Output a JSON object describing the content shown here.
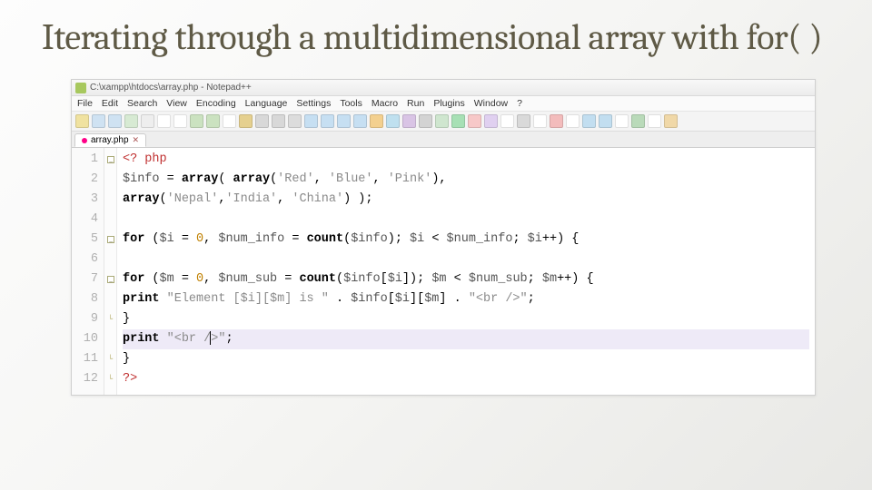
{
  "slide": {
    "title": "Iterating through a multidimensional array with for( )"
  },
  "window": {
    "title": "C:\\xampp\\htdocs\\array.php - Notepad++"
  },
  "menu": {
    "items": [
      "File",
      "Edit",
      "Search",
      "View",
      "Encoding",
      "Language",
      "Settings",
      "Tools",
      "Macro",
      "Run",
      "Plugins",
      "Window",
      "?"
    ]
  },
  "toolbar_colors": [
    "#f0e2a0",
    "#cfe2f2",
    "#cfe2f2",
    "#d7ead3",
    "#eee",
    "#fff",
    "#fff",
    "#cbe2c0",
    "#cbe2c0",
    "#fff",
    "#e5d08f",
    "#d8d8d8",
    "#d8d8d8",
    "#dcdcdc",
    "#c6dff2",
    "#c6dff2",
    "#c6dff2",
    "#c6dff2",
    "#f3d08f",
    "#bfe0ef",
    "#d9c4e5",
    "#d3d3d3",
    "#cfe6cf",
    "#a7e0b5",
    "#f7c8c8",
    "#e0d0f0",
    "#fff",
    "#d9d9d9",
    "#fff",
    "#f3bcbc",
    "#fff",
    "#c2def0",
    "#c2def0",
    "#fff",
    "#b9dab9",
    "#fff",
    "#f0d8a8"
  ],
  "tab": {
    "label": "array.php"
  },
  "code": {
    "lines": [
      {
        "n": 1,
        "fold": "box",
        "seg": [
          {
            "t": "<? php",
            "c": "kw-red"
          }
        ]
      },
      {
        "n": 2,
        "fold": "",
        "seg": [
          {
            "t": "$info",
            "c": "var"
          },
          {
            "t": " = ",
            "c": "op"
          },
          {
            "t": "array",
            "c": "kw-bold"
          },
          {
            "t": "( ",
            "c": "op"
          },
          {
            "t": "array",
            "c": "kw-bold"
          },
          {
            "t": "(",
            "c": "op"
          },
          {
            "t": "'Red'",
            "c": "str"
          },
          {
            "t": ", ",
            "c": "op"
          },
          {
            "t": "'Blue'",
            "c": "str"
          },
          {
            "t": ", ",
            "c": "op"
          },
          {
            "t": "'Pink'",
            "c": "str"
          },
          {
            "t": "),",
            "c": "op"
          }
        ]
      },
      {
        "n": 3,
        "fold": "",
        "seg": [
          {
            "t": "array",
            "c": "kw-bold"
          },
          {
            "t": "(",
            "c": "op"
          },
          {
            "t": "'Nepal'",
            "c": "str"
          },
          {
            "t": ",",
            "c": "op"
          },
          {
            "t": "'India'",
            "c": "str"
          },
          {
            "t": ", ",
            "c": "op"
          },
          {
            "t": "'China'",
            "c": "str"
          },
          {
            "t": ") );",
            "c": "op"
          }
        ]
      },
      {
        "n": 4,
        "fold": "",
        "seg": []
      },
      {
        "n": 5,
        "fold": "box",
        "seg": [
          {
            "t": "for",
            "c": "kw-bold"
          },
          {
            "t": " (",
            "c": "op"
          },
          {
            "t": "$i",
            "c": "var"
          },
          {
            "t": " = ",
            "c": "op"
          },
          {
            "t": "0",
            "c": "num"
          },
          {
            "t": ", ",
            "c": "op"
          },
          {
            "t": "$num_info",
            "c": "var"
          },
          {
            "t": " = ",
            "c": "op"
          },
          {
            "t": "count",
            "c": "kw-bold"
          },
          {
            "t": "(",
            "c": "op"
          },
          {
            "t": "$info",
            "c": "var"
          },
          {
            "t": "); ",
            "c": "op"
          },
          {
            "t": "$i",
            "c": "var"
          },
          {
            "t": " < ",
            "c": "op"
          },
          {
            "t": "$num_info",
            "c": "var"
          },
          {
            "t": "; ",
            "c": "op"
          },
          {
            "t": "$i",
            "c": "var"
          },
          {
            "t": "++) {",
            "c": "op"
          }
        ]
      },
      {
        "n": 6,
        "fold": "",
        "seg": []
      },
      {
        "n": 7,
        "fold": "box",
        "seg": [
          {
            "t": "for",
            "c": "kw-bold"
          },
          {
            "t": " (",
            "c": "op"
          },
          {
            "t": "$m",
            "c": "var"
          },
          {
            "t": " = ",
            "c": "op"
          },
          {
            "t": "0",
            "c": "num"
          },
          {
            "t": ", ",
            "c": "op"
          },
          {
            "t": "$num_sub",
            "c": "var"
          },
          {
            "t": " = ",
            "c": "op"
          },
          {
            "t": "count",
            "c": "kw-bold"
          },
          {
            "t": "(",
            "c": "op"
          },
          {
            "t": "$info",
            "c": "var"
          },
          {
            "t": "[",
            "c": "op"
          },
          {
            "t": "$i",
            "c": "var"
          },
          {
            "t": "]); ",
            "c": "op"
          },
          {
            "t": "$m",
            "c": "var"
          },
          {
            "t": " < ",
            "c": "op"
          },
          {
            "t": "$num_sub",
            "c": "var"
          },
          {
            "t": "; ",
            "c": "op"
          },
          {
            "t": "$m",
            "c": "var"
          },
          {
            "t": "++) {",
            "c": "op"
          }
        ]
      },
      {
        "n": 8,
        "fold": "",
        "seg": [
          {
            "t": "print",
            "c": "kw-bold"
          },
          {
            "t": " ",
            "c": "op"
          },
          {
            "t": "\"Element [$i][$m] is \"",
            "c": "str"
          },
          {
            "t": " . ",
            "c": "op"
          },
          {
            "t": "$info",
            "c": "var"
          },
          {
            "t": "[",
            "c": "op"
          },
          {
            "t": "$i",
            "c": "var"
          },
          {
            "t": "][",
            "c": "op"
          },
          {
            "t": "$m",
            "c": "var"
          },
          {
            "t": "] . ",
            "c": "op"
          },
          {
            "t": "\"<br />\"",
            "c": "str"
          },
          {
            "t": ";",
            "c": "op"
          }
        ]
      },
      {
        "n": 9,
        "fold": "close",
        "seg": [
          {
            "t": "}",
            "c": "op"
          }
        ]
      },
      {
        "n": 10,
        "fold": "",
        "current": true,
        "seg": [
          {
            "t": "print",
            "c": "kw-bold"
          },
          {
            "t": " ",
            "c": "op"
          },
          {
            "t": "\"<br /",
            "c": "str"
          },
          {
            "t": "",
            "cursor": true
          },
          {
            "t": ">\"",
            "c": "str"
          },
          {
            "t": ";",
            "c": "op"
          }
        ]
      },
      {
        "n": 11,
        "fold": "close",
        "seg": [
          {
            "t": "}",
            "c": "op"
          }
        ]
      },
      {
        "n": 12,
        "fold": "close",
        "seg": [
          {
            "t": "?>",
            "c": "kw-red"
          }
        ]
      }
    ]
  }
}
